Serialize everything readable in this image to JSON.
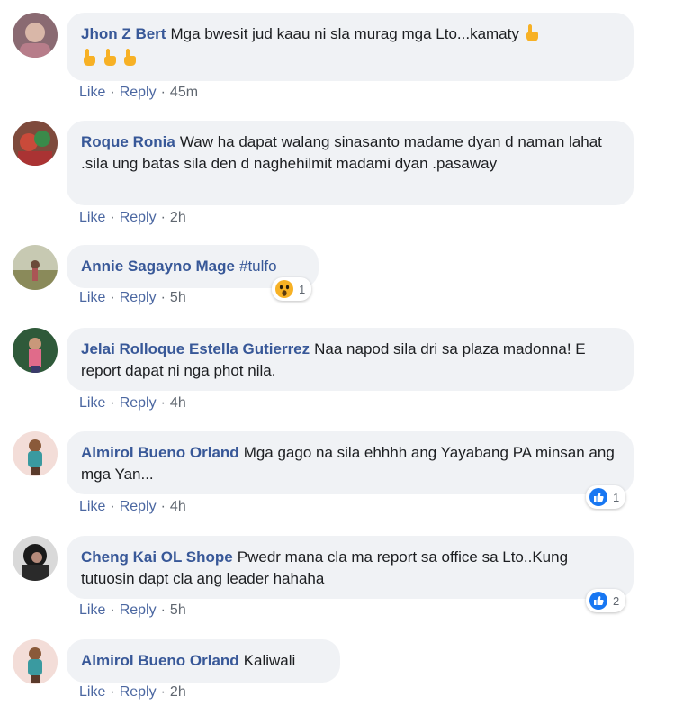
{
  "actions": {
    "like": "Like",
    "reply": "Reply",
    "separator": "·"
  },
  "comments": [
    {
      "author": "Jhon Z Bert",
      "text": "Mga bwesit jud kaau ni sla murag mga Lto...kamaty",
      "emoji_icons": [
        "pointing-up-icon",
        "pointing-up-icon",
        "pointing-up-icon",
        "pointing-up-icon"
      ],
      "time": "45m"
    },
    {
      "author": "Roque Ronia",
      "text": "Waw ha dapat walang sinasanto madame dyan d naman lahat .sila ung batas sila den d naghehilmit madami dyan .pasaway",
      "time": "2h"
    },
    {
      "author": "Annie Sagayno Mage",
      "text": "#tulfo",
      "time": "5h",
      "reaction": {
        "icon": "wow-reaction-icon",
        "count": "1"
      }
    },
    {
      "author": "Jelai Rolloque Estella Gutierrez",
      "text": "Naa napod sila dri sa plaza madonna! E report dapat ni nga phot nila.",
      "time": "4h"
    },
    {
      "author": "Almirol Bueno Orland",
      "text": "Mga gago na sila ehhhh ang Yayabang PA minsan ang mga Yan...",
      "time": "4h",
      "reaction": {
        "icon": "like-reaction-icon",
        "count": "1"
      }
    },
    {
      "author": "Cheng Kai OL Shope",
      "text": "Pwedr mana cla ma report sa office sa Lto..Kung tutuosin dapt cla ang leader hahaha",
      "time": "5h",
      "reaction": {
        "icon": "like-reaction-icon",
        "count": "2"
      }
    },
    {
      "author": "Almirol Bueno Orland",
      "text": "Kaliwali",
      "time": "2h"
    }
  ],
  "colors": {
    "link": "#385898",
    "bubble": "#f0f2f5",
    "like_blue": "#1877f2",
    "wow_yellow": "#f7b125"
  }
}
